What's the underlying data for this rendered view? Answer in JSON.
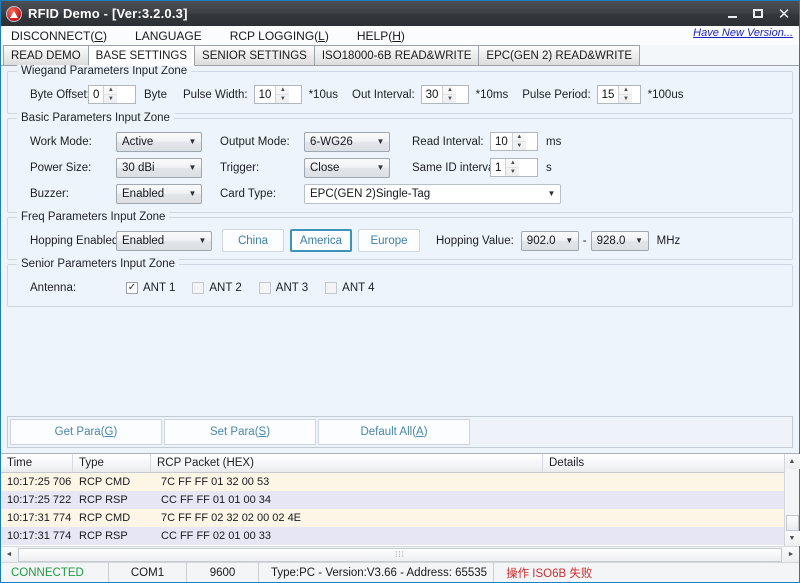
{
  "window": {
    "title": "RFID Demo - [Ver:3.2.0.3]",
    "icon": "rfid-app-icon",
    "minimize": "_",
    "maximize": "□",
    "close": "✕"
  },
  "menu": {
    "items": [
      {
        "label": "DISCONNECT(C)",
        "pre": "DISCONNECT(",
        "key": "C",
        "post": ")"
      },
      {
        "label": "LANGUAGE",
        "pre": "LANGUAGE",
        "key": "",
        "post": ""
      },
      {
        "label": "RCP LOGGING(L)",
        "pre": "RCP LOGGING(",
        "key": "L",
        "post": ")"
      },
      {
        "label": "HELP(H)",
        "pre": "HELP(",
        "key": "H",
        "post": ")"
      }
    ],
    "new_version_link": "Have New Version..."
  },
  "tabs": [
    {
      "label": "READ DEMO",
      "active": false
    },
    {
      "label": "BASE SETTINGS",
      "active": true
    },
    {
      "label": "SENIOR SETTINGS",
      "active": false
    },
    {
      "label": "ISO18000-6B READ&WRITE",
      "active": false
    },
    {
      "label": "EPC(GEN 2) READ&WRITE",
      "active": false
    }
  ],
  "wiegand": {
    "title": "Wiegand Parameters Input Zone",
    "byte_offset_label": "Byte Offset:",
    "byte_offset_value": "0",
    "byte_unit": "Byte",
    "pulse_width_label": "Pulse Width:",
    "pulse_width_value": "10",
    "pulse_width_unit": "*10us",
    "out_interval_label": "Out Interval:",
    "out_interval_value": "30",
    "out_interval_unit": "*10ms",
    "pulse_period_label": "Pulse Period:",
    "pulse_period_value": "15",
    "pulse_period_unit": "*100us"
  },
  "basic": {
    "title": "Basic Parameters Input Zone",
    "work_mode_label": "Work Mode:",
    "work_mode_value": "Active",
    "power_size_label": "Power Size:",
    "power_size_value": "30 dBi",
    "buzzer_label": "Buzzer:",
    "buzzer_value": "Enabled",
    "output_mode_label": "Output Mode:",
    "output_mode_value": "6-WG26",
    "trigger_label": "Trigger:",
    "trigger_value": "Close",
    "card_type_label": "Card Type:",
    "card_type_value": "EPC(GEN 2)Single-Tag",
    "read_interval_label": "Read Interval:",
    "read_interval_value": "10",
    "read_interval_unit": "ms",
    "same_id_label": "Same ID interval:",
    "same_id_value": "1",
    "same_id_unit": "s"
  },
  "freq": {
    "title": "Freq Parameters Input Zone",
    "hopping_enabled_label": "Hopping Enabled:",
    "hopping_enabled_value": "Enabled",
    "regions": [
      {
        "label": "China",
        "selected": false
      },
      {
        "label": "America",
        "selected": true
      },
      {
        "label": "Europe",
        "selected": false
      }
    ],
    "hopping_value_label": "Hopping Value:",
    "hopping_low": "902.0",
    "hopping_dash": "-",
    "hopping_high": "928.0",
    "hopping_unit": "MHz"
  },
  "senior": {
    "title": "Senior Parameters Input Zone",
    "antenna_label": "Antenna:",
    "antennas": [
      {
        "label": "ANT 1",
        "checked": true
      },
      {
        "label": "ANT 2",
        "checked": false
      },
      {
        "label": "ANT 3",
        "checked": false
      },
      {
        "label": "ANT 4",
        "checked": false
      }
    ],
    "check_glyph": "✓"
  },
  "actions": [
    {
      "label": "Get Para(G)",
      "pre": "Get Para(",
      "key": "G",
      "post": ")"
    },
    {
      "label": "Set Para(S)",
      "pre": "Set Para(",
      "key": "S",
      "post": ")"
    },
    {
      "label": "Default All(A)",
      "pre": "Default All(",
      "key": "A",
      "post": ")"
    }
  ],
  "log": {
    "columns": [
      "Time",
      "Type",
      "RCP Packet (HEX)",
      "Details"
    ],
    "rows": [
      {
        "time": "10:17:25 706",
        "type": "RCP CMD",
        "packet": "7C FF FF 01 32 00 53",
        "details": "",
        "kind": "cmd"
      },
      {
        "time": "10:17:25 722",
        "type": "RCP RSP",
        "packet": "CC FF FF 01 01 00 34",
        "details": "",
        "kind": "rsp"
      },
      {
        "time": "10:17:31 774",
        "type": "RCP CMD",
        "packet": "7C FF FF 02 32 02 00 02 4E",
        "details": "",
        "kind": "cmd"
      },
      {
        "time": "10:17:31 774",
        "type": "RCP RSP",
        "packet": "CC FF FF 02 01 00 33",
        "details": "",
        "kind": "rsp"
      }
    ],
    "scroll_up": "▲",
    "scroll_down": "▼",
    "scroll_left": "◄",
    "scroll_right": "►",
    "grip": "⁞⁞⁞"
  },
  "status": {
    "connection": "CONNECTED",
    "port": "COM1",
    "baud": "9600",
    "info": "Type:PC - Version:V3.66 - Address: 65535",
    "error": "操作 ISO6B 失败"
  },
  "colors": {
    "accent": "#1a7fc1",
    "link": "#1d22c6",
    "region_text": "#3c7fa8",
    "region_selected_border": "#3e93b8",
    "button_text": "#4a86ab",
    "connected_green": "#1f9b3f",
    "error_red": "#d02b2b",
    "row_cmd": "#fdf5e6",
    "row_rsp": "#e6e6f4",
    "panel_bg": "#eef4fb"
  }
}
